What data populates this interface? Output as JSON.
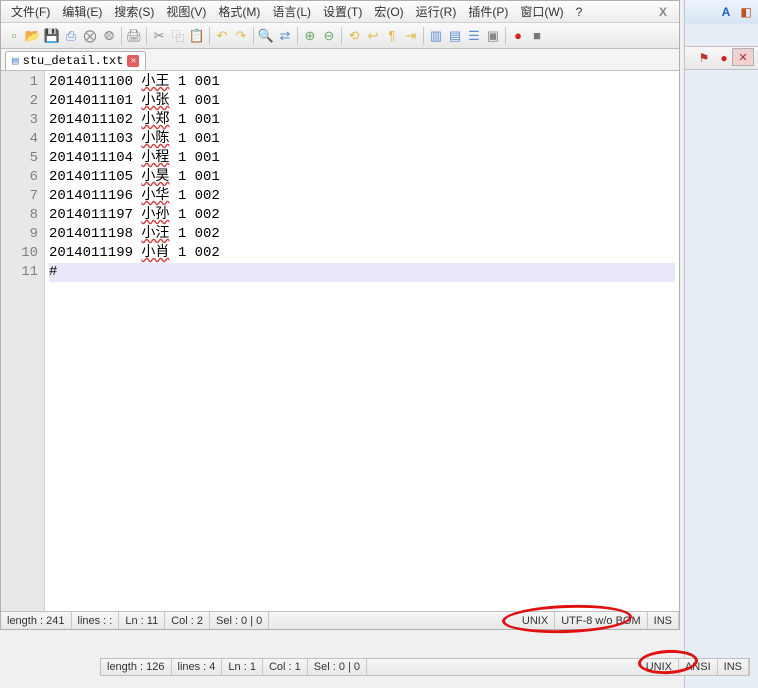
{
  "menu": {
    "items": [
      "文件(F)",
      "编辑(E)",
      "搜索(S)",
      "视图(V)",
      "格式(M)",
      "语言(L)",
      "设置(T)",
      "宏(O)",
      "运行(R)",
      "插件(P)",
      "窗口(W)",
      "?"
    ],
    "close_x": "X"
  },
  "tab": {
    "filename": "stu_detail.txt",
    "close": "✕"
  },
  "editor": {
    "lines": [
      {
        "id": "2014011100",
        "name": "小王",
        "c1": "1",
        "c2": "001"
      },
      {
        "id": "2014011101",
        "name": "小张",
        "c1": "1",
        "c2": "001"
      },
      {
        "id": "2014011102",
        "name": "小郑",
        "c1": "1",
        "c2": "001"
      },
      {
        "id": "2014011103",
        "name": "小陈",
        "c1": "1",
        "c2": "001"
      },
      {
        "id": "2014011104",
        "name": "小程",
        "c1": "1",
        "c2": "001"
      },
      {
        "id": "2014011105",
        "name": "小昊",
        "c1": "1",
        "c2": "001"
      },
      {
        "id": "2014011196",
        "name": "小华",
        "c1": "1",
        "c2": "002"
      },
      {
        "id": "2014011197",
        "name": "小孙",
        "c1": "1",
        "c2": "002"
      },
      {
        "id": "2014011198",
        "name": "小汪",
        "c1": "1",
        "c2": "002"
      },
      {
        "id": "2014011199",
        "name": "小肖",
        "c1": "1",
        "c2": "002"
      }
    ],
    "cursor_char": "#"
  },
  "status1": {
    "length": "length : 241",
    "lines": "lines : :",
    "ln": "Ln : 11",
    "col": "Col : 2",
    "sel": "Sel : 0 | 0",
    "eol": "UNIX",
    "enc": "UTF-8 w/o BOM",
    "ins": "INS"
  },
  "status2": {
    "length": "length : 126",
    "lines": "lines : 4",
    "ln": "Ln : 1",
    "col": "Col : 1",
    "sel": "Sel : 0 | 0",
    "eol": "UNIX",
    "enc": "ANSI",
    "ins": "INS"
  },
  "right": {
    "close": "✕"
  }
}
